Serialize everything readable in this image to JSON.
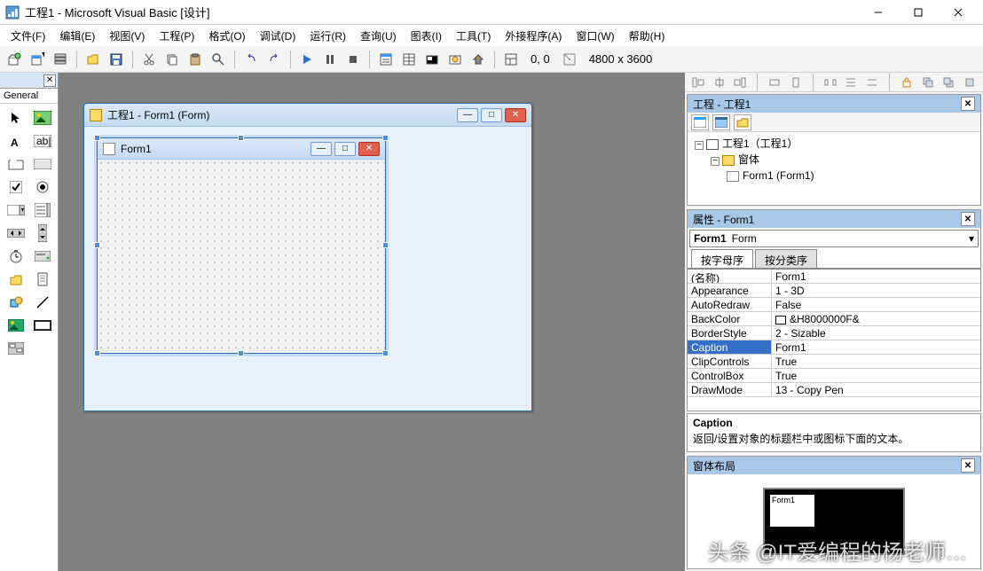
{
  "titlebar": {
    "title": "工程1 - Microsoft Visual Basic [设计]"
  },
  "menu": [
    "文件(F)",
    "编辑(E)",
    "视图(V)",
    "工程(P)",
    "格式(O)",
    "调试(D)",
    "运行(R)",
    "查询(U)",
    "图表(I)",
    "工具(T)",
    "外接程序(A)",
    "窗口(W)",
    "帮助(H)"
  ],
  "toolbar": {
    "coords": "0, 0",
    "dims": "4800 x 3600"
  },
  "toolbox": {
    "tab": "General"
  },
  "designer": {
    "container_title": "工程1 - Form1 (Form)",
    "form_caption": "Form1"
  },
  "project": {
    "panel_title": "工程 - 工程1",
    "root": "工程1（工程1）",
    "folder": "窗体",
    "form": "Form1 (Form1)"
  },
  "properties": {
    "panel_title": "属性 - Form1",
    "object_name": "Form1",
    "object_type": "Form",
    "tab_alpha": "按字母序",
    "tab_cat": "按分类序",
    "rows": [
      {
        "n": "(名称)",
        "v": "Form1"
      },
      {
        "n": "Appearance",
        "v": "1 - 3D"
      },
      {
        "n": "AutoRedraw",
        "v": "False"
      },
      {
        "n": "BackColor",
        "v": "&H8000000F&",
        "swatch": true
      },
      {
        "n": "BorderStyle",
        "v": "2 - Sizable"
      },
      {
        "n": "Caption",
        "v": "Form1",
        "sel": true
      },
      {
        "n": "ClipControls",
        "v": "True"
      },
      {
        "n": "ControlBox",
        "v": "True"
      },
      {
        "n": "DrawMode",
        "v": "13 - Copy Pen"
      }
    ],
    "desc_title": "Caption",
    "desc_text": "返回/设置对象的标题栏中或图标下面的文本。"
  },
  "layout": {
    "panel_title": "窗体布局",
    "form_label": "Form1"
  },
  "watermark": "头条 @IT爱编程的杨老师…"
}
